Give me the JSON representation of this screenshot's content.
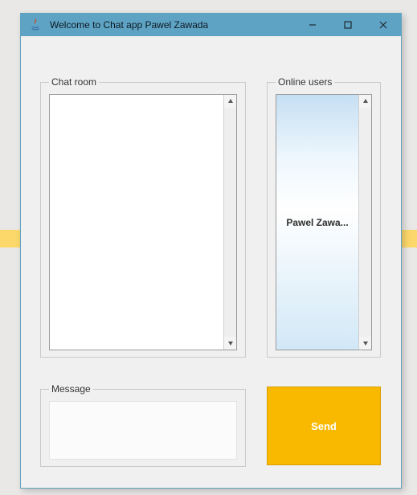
{
  "window": {
    "title": "Welcome to Chat app Pawel Zawada"
  },
  "panels": {
    "chat_room_label": "Chat room",
    "online_users_label": "Online users",
    "message_label": "Message"
  },
  "online_users": {
    "items": [
      {
        "display": "Pawel Zawa..."
      }
    ]
  },
  "chat_room": {
    "content": ""
  },
  "message": {
    "value": "",
    "placeholder": ""
  },
  "buttons": {
    "send_label": "Send"
  }
}
